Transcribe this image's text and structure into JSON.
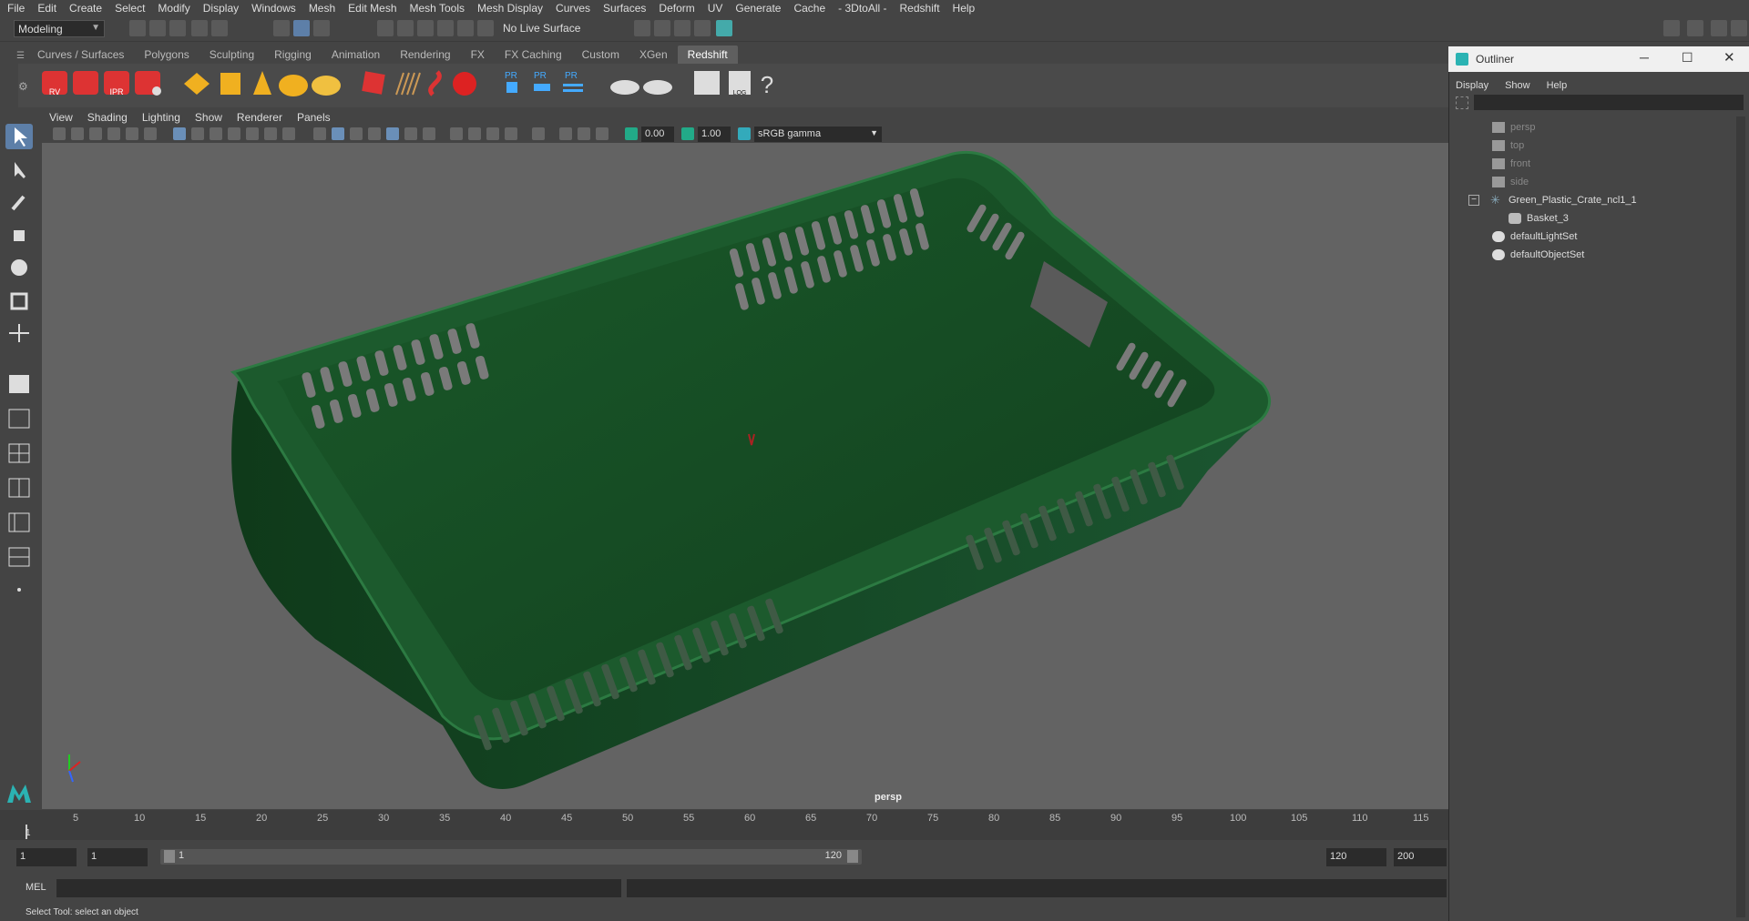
{
  "menubar": {
    "items": [
      "File",
      "Edit",
      "Create",
      "Select",
      "Modify",
      "Display",
      "Windows",
      "Mesh",
      "Edit Mesh",
      "Mesh Tools",
      "Mesh Display",
      "Curves",
      "Surfaces",
      "Deform",
      "UV",
      "Generate",
      "Cache",
      "- 3DtoAll -",
      "Redshift",
      "Help"
    ]
  },
  "status": {
    "mode": "Modeling",
    "live_surface": "No Live Surface"
  },
  "shelf_tabs": [
    "Curves / Surfaces",
    "Polygons",
    "Sculpting",
    "Rigging",
    "Animation",
    "Rendering",
    "FX",
    "FX Caching",
    "Custom",
    "XGen",
    "Redshift"
  ],
  "shelf_active": "Redshift",
  "shelf_labels": {
    "rv": "RV",
    "ipr": "IPR",
    "pr1": "PR",
    "pr2": "PR",
    "pr3": "PR",
    "log": "LOG",
    "help": "?"
  },
  "viewport": {
    "menu": [
      "View",
      "Shading",
      "Lighting",
      "Show",
      "Renderer",
      "Panels"
    ],
    "exposure": "0.00",
    "gamma": "1.00",
    "colorspace": "sRGB gamma",
    "camera": "persp"
  },
  "timeline": {
    "ticks": [
      "5",
      "10",
      "15",
      "20",
      "25",
      "30",
      "35",
      "40",
      "45",
      "50",
      "55",
      "60",
      "65",
      "70",
      "75",
      "80",
      "85",
      "90",
      "95",
      "100",
      "105",
      "110",
      "115"
    ],
    "current": "1"
  },
  "range": {
    "start": "1",
    "anim_start": "1",
    "slider_start": "1",
    "slider_end": "120",
    "end": "120",
    "anim_end": "200"
  },
  "cmd": {
    "label": "MEL"
  },
  "status_message": "Select Tool: select an object",
  "outliner": {
    "title": "Outliner",
    "menu": [
      "Display",
      "Show",
      "Help"
    ],
    "items": [
      {
        "label": "persp",
        "icon": "camera-icon",
        "dim": true
      },
      {
        "label": "top",
        "icon": "camera-icon",
        "dim": true
      },
      {
        "label": "front",
        "icon": "camera-icon",
        "dim": true
      },
      {
        "label": "side",
        "icon": "camera-icon",
        "dim": true
      },
      {
        "label": "Green_Plastic_Crate_ncl1_1",
        "icon": "transform-icon",
        "dim": false
      },
      {
        "label": "Basket_3",
        "icon": "mesh-icon",
        "dim": false
      },
      {
        "label": "defaultLightSet",
        "icon": "set-icon",
        "dim": false
      },
      {
        "label": "defaultObjectSet",
        "icon": "set-icon",
        "dim": false
      }
    ]
  },
  "colors": {
    "accent": "#5d7fa8",
    "crate": "#1f5a2b",
    "viewport_bg": "#636363"
  }
}
